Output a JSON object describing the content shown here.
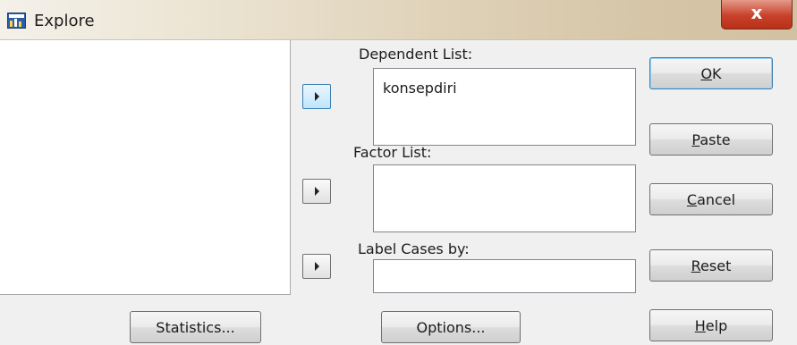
{
  "window": {
    "title": "Explore",
    "close_glyph": "x"
  },
  "lists": {
    "dependent": {
      "label": "Dependent List:",
      "items": [
        "konsepdiri"
      ]
    },
    "factor": {
      "label": "Factor List:",
      "items": []
    },
    "label_cases": {
      "label": "Label Cases by:",
      "value": ""
    }
  },
  "buttons": {
    "ok": {
      "mnemonic": "O",
      "rest": "K"
    },
    "paste": {
      "mnemonic": "P",
      "rest": "aste"
    },
    "cancel": {
      "mnemonic": "C",
      "rest": "ancel"
    },
    "reset": {
      "mnemonic": "R",
      "rest": "eset"
    },
    "help": {
      "mnemonic": "H",
      "rest": "elp"
    },
    "statistics": "Statistics...",
    "options": "Options..."
  },
  "icons": {
    "app": "explore-icon",
    "move_arrow": "right-arrow-icon"
  }
}
